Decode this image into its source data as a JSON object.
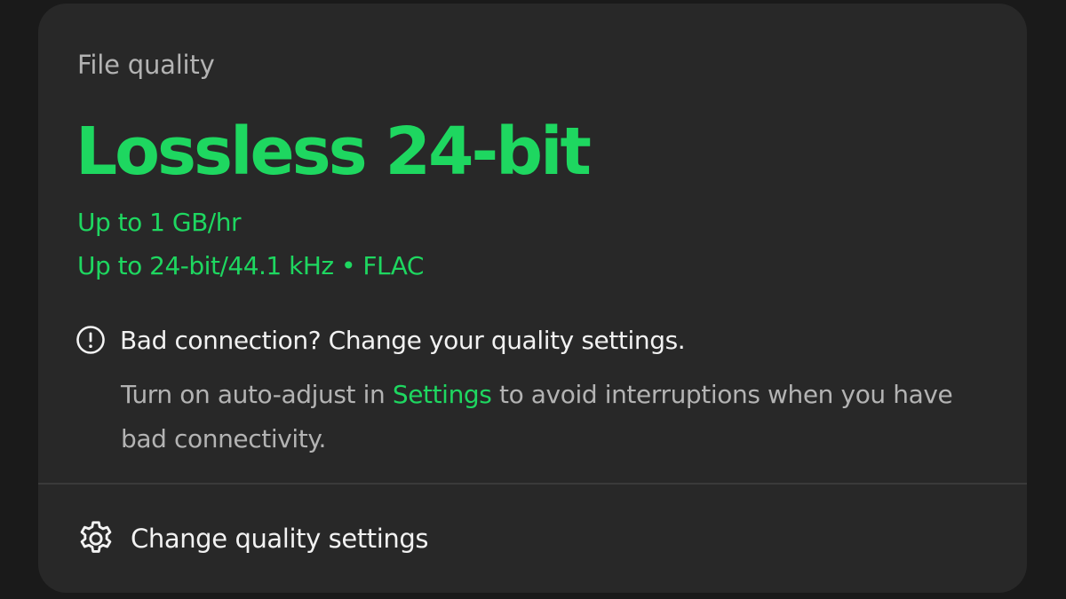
{
  "card": {
    "label": "File quality",
    "title": "Lossless 24-bit",
    "specs": [
      "Up to 1 GB/hr",
      "Up to 24-bit/44.1 kHz • FLAC"
    ]
  },
  "warning": {
    "icon": "exclamation-circle-icon",
    "title": "Bad connection? Change your quality settings.",
    "body_before": "Turn on auto-adjust in ",
    "body_link": "Settings",
    "body_after": " to avoid interruptions when you have bad connectivity."
  },
  "action": {
    "icon": "gear-icon",
    "label": "Change quality settings"
  },
  "colors": {
    "accent": "#1ed760",
    "card_bg": "#282828",
    "page_bg": "#1a1a1a"
  }
}
